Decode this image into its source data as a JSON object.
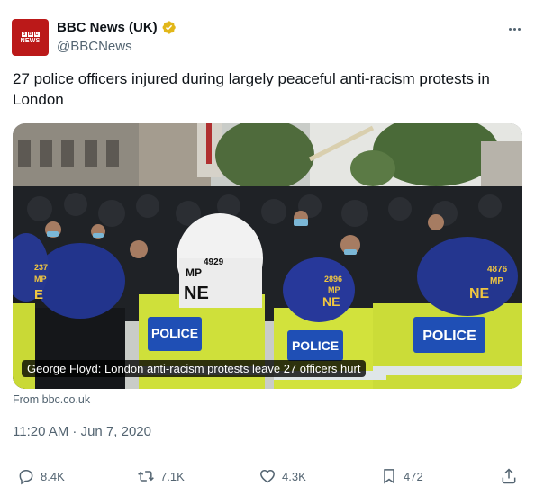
{
  "account": {
    "display_name": "BBC News (UK)",
    "handle": "@BBCNews",
    "avatar_letters": [
      "B",
      "B",
      "C"
    ],
    "avatar_word": "NEWS",
    "verified_color": "#e2b719",
    "avatar_color": "#bb1919"
  },
  "tweet": {
    "text": "27 police officers injured during largely peaceful anti-racism protests in London"
  },
  "card": {
    "caption": "George Floyd: London anti-racism protests leave 27 officers hurt",
    "source": "From bbc.co.uk",
    "helmet_labels": [
      "4929",
      "MP",
      "NE",
      "237",
      "MP",
      "E",
      "2896",
      "MP",
      "NE",
      "4876",
      "MP",
      "NE"
    ],
    "vest_labels": [
      "POLICE",
      "POLICE",
      "POLICE"
    ]
  },
  "meta": {
    "timestamp": "11:20 AM · Jun 7, 2020"
  },
  "actions": {
    "replies": "8.4K",
    "retweets": "7.1K",
    "likes": "4.3K",
    "bookmarks": "472"
  },
  "icons": [
    "more-icon",
    "verified-icon",
    "reply-icon",
    "retweet-icon",
    "like-icon",
    "bookmark-icon",
    "share-icon"
  ]
}
